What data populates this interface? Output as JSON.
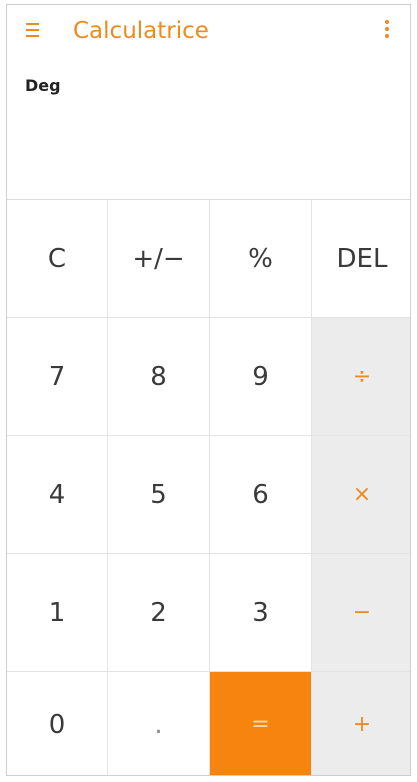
{
  "app": {
    "title": "Calculatrice",
    "mode": "Deg",
    "accent_color": "#f08a1e",
    "menu_icon": "hamburger-menu-icon",
    "overflow_icon": "overflow-menu-icon"
  },
  "display": {
    "expression": "",
    "result": ""
  },
  "keys": {
    "clear": "C",
    "negate": "+/−",
    "percent": "%",
    "delete": "DEL",
    "seven": "7",
    "eight": "8",
    "nine": "9",
    "divide": "÷",
    "four": "4",
    "five": "5",
    "six": "6",
    "multiply": "×",
    "one": "1",
    "two": "2",
    "three": "3",
    "minus": "−",
    "zero": "0",
    "decimal": ".",
    "equals": "=",
    "plus": "+"
  }
}
